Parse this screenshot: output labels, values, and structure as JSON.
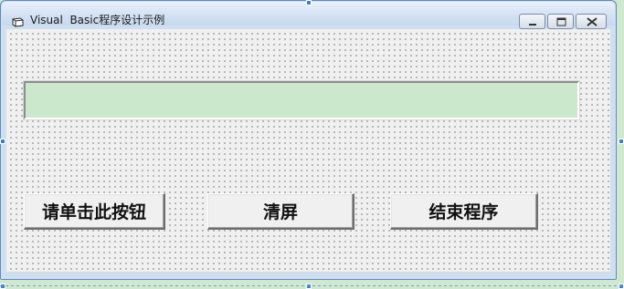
{
  "window": {
    "title": "Visual  Basic程序设计示例",
    "icon": "vb-form-icon",
    "controls": {
      "minimize_icon": "minimize-icon",
      "maximize_icon": "maximize-icon",
      "close_icon": "close-icon"
    }
  },
  "form": {
    "textbox_value": "",
    "textbox_color": "#cce8cc",
    "buttons": {
      "click_label": "请单击此按钮",
      "clear_label": "清屏",
      "exit_label": "结束程序"
    }
  },
  "colors": {
    "background": "#cfe8cf",
    "window_frame": "#5d8cbe",
    "selection_handle": "#3f7fd0"
  }
}
